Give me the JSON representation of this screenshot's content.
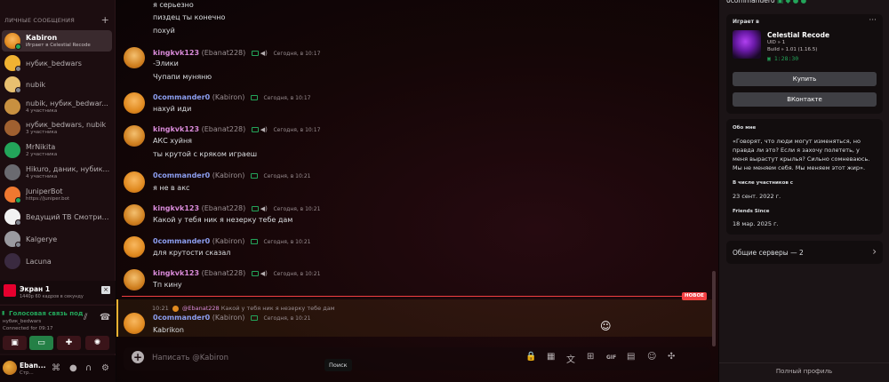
{
  "sidebar": {
    "dm_header": "ЛИЧНЫЕ СООБЩЕНИЯ",
    "add_label": "+",
    "dms": [
      {
        "name": "Kabiron",
        "sub": "Играет в Celestial Recode"
      },
      {
        "name": "нубик_bedwars",
        "sub": ""
      },
      {
        "name": "nubik",
        "sub": ""
      },
      {
        "name": "nubik, нубик_bedwar...",
        "sub": "4 участника"
      },
      {
        "name": "нубик_bedwars, nubik",
        "sub": "3 участника"
      },
      {
        "name": "MrNikita",
        "sub": "2 участника"
      },
      {
        "name": "Hikuro, даник, нубик...",
        "sub": "4 участника"
      },
      {
        "name": "JuniperBot",
        "sub": "https://juniper.bot"
      },
      {
        "name": "Ведущий ТВ Смотрит...",
        "sub": ""
      },
      {
        "name": "Kalgerye",
        "sub": ""
      },
      {
        "name": "Lacuna",
        "sub": ""
      }
    ],
    "screen_share": {
      "title": "Экран 1",
      "detail": "1440p 60 кадров в секунду"
    },
    "voice": {
      "title": "Голосовая связь под",
      "channel": "нубик_bedwars",
      "status": "Connected for 09:17"
    },
    "user": {
      "name": "Eban...",
      "status": "Стр..."
    }
  },
  "chat": {
    "top_lines": [
      "я серьезно",
      "пиздец ты конечно",
      "похуй"
    ],
    "messages": [
      {
        "author": "kingkvk123",
        "nick": "(Ebanat228)",
        "time": "Сегодня, в 10:17",
        "lines": [
          "-Элики",
          "Чупапи муняню"
        ],
        "speaker": true
      },
      {
        "author": "0commander0",
        "nick": "(Kabiron)",
        "time": "Сегодня, в 10:17",
        "lines": [
          "нахуй иди"
        ],
        "speaker": false
      },
      {
        "author": "kingkvk123",
        "nick": "(Ebanat228)",
        "time": "Сегодня, в 10:17",
        "lines": [
          "АКС хуйня",
          "ты крутой с кряком играеш"
        ],
        "speaker": true
      },
      {
        "author": "0commander0",
        "nick": "(Kabiron)",
        "time": "Сегодня, в 10:21",
        "lines": [
          "я не в акс"
        ],
        "speaker": false
      },
      {
        "author": "kingkvk123",
        "nick": "(Ebanat228)",
        "time": "Сегодня, в 10:21",
        "lines": [
          "Какой у тебя ник я незерку тебе дам"
        ],
        "speaker": true
      },
      {
        "author": "0commander0",
        "nick": "(Kabiron)",
        "time": "Сегодня, в 10:21",
        "lines": [
          "для крутости сказал"
        ],
        "speaker": false
      },
      {
        "author": "kingkvk123",
        "nick": "(Ebanat228)",
        "time": "Сегодня, в 10:21",
        "lines": [
          "Тп кину"
        ],
        "speaker": true
      },
      {
        "author": "0commander0",
        "nick": "(Kabiron)",
        "time": "Сегодня, в 10:21",
        "lines": [
          "Kabrikon"
        ],
        "speaker": false
      }
    ],
    "new_label": "НОВОЕ",
    "reply": {
      "time": "10:21",
      "author": "@Ebanat228",
      "text": "Какой у тебя ник я незерку тебе дам"
    },
    "composer_placeholder": "Написать @Kabiron",
    "tooltip": "Поиск",
    "tools": [
      "lock-icon",
      "calendar-icon",
      "translate-icon",
      "gift-icon",
      "gif-icon",
      "sticker-icon",
      "emoji-icon",
      "apps-icon"
    ]
  },
  "profile": {
    "top_name": "0commander0",
    "playing_label": "Играет в",
    "game_name": "Celestial Recode",
    "uid": "UID » 1",
    "build": "Build » 1.01 (1.16.5)",
    "elapsed": "1:28:30",
    "buy_label": "Купить",
    "vk_label": "ВКонтакте",
    "about_label": "Обо мне",
    "about_text": "«Говорят, что люди могут изменяться, но правда ли это? Если я захочу полететь, у меня вырастут крылья? Сильно сомневаюсь. Мы не меняем себя. Мы меняем этот жир».",
    "member_since_label": "В числе участников с",
    "member_since": "23 сент. 2022 г.",
    "friends_since_label": "Friends Since",
    "friends_since": "18 мар. 2025 г.",
    "servers_label": "Общие серверы — 2",
    "full_profile": "Полный профиль"
  },
  "colors": {
    "accent_green": "#23a55a",
    "new_red": "#f23f42",
    "author_pink": "#d88ad8",
    "author_blue": "#8c9ef0"
  }
}
